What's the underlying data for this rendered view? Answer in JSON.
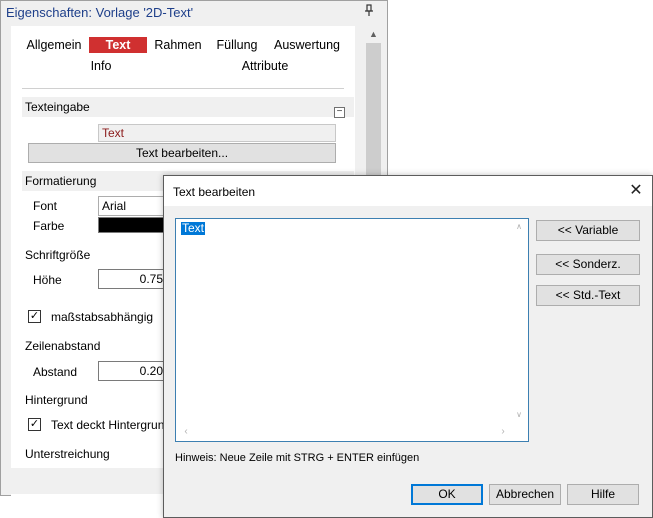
{
  "panel": {
    "title": "Eigenschaften: Vorlage '2D-Text'",
    "pin_icon": "pin-icon",
    "tabs_row1": [
      "Allgemein",
      "Text",
      "Rahmen",
      "Füllung",
      "Auswertung"
    ],
    "tabs_row2": [
      "Info",
      "Attribute"
    ],
    "active_tab": "Text",
    "active_tab_color": "#d03030",
    "sections": {
      "texteingabe": "Texteingabe",
      "formatierung": "Formatierung"
    },
    "text_value": "Text",
    "edit_text_button": "Text bearbeiten...",
    "font_label": "Font",
    "font_value": "Arial",
    "color_label": "Farbe",
    "color_value": "#000000",
    "schriftgroesse_label": "Schriftgröße",
    "hoehe_label": "Höhe",
    "hoehe_value": "0.75",
    "massstab_label": "maßstabsabhängig",
    "massstab_checked": true,
    "zeilenabstand_label": "Zeilenabstand",
    "abstand_label": "Abstand",
    "abstand_value": "0.20",
    "hintergrund_label": "Hintergrund",
    "text_deckt_label": "Text deckt Hintergrund",
    "text_deckt_checked": true,
    "unterstreichung_label": "Unterstreichung"
  },
  "dialog": {
    "title": "Text bearbeiten",
    "close_icon": "close-icon",
    "editor_text": "Text",
    "buttons_side": [
      "<< Variable",
      "<< Sonderz.",
      "<< Std.-Text"
    ],
    "hint": "Hinweis: Neue Zeile mit STRG + ENTER einfügen",
    "ok": "OK",
    "cancel": "Abbrechen",
    "help": "Hilfe"
  }
}
